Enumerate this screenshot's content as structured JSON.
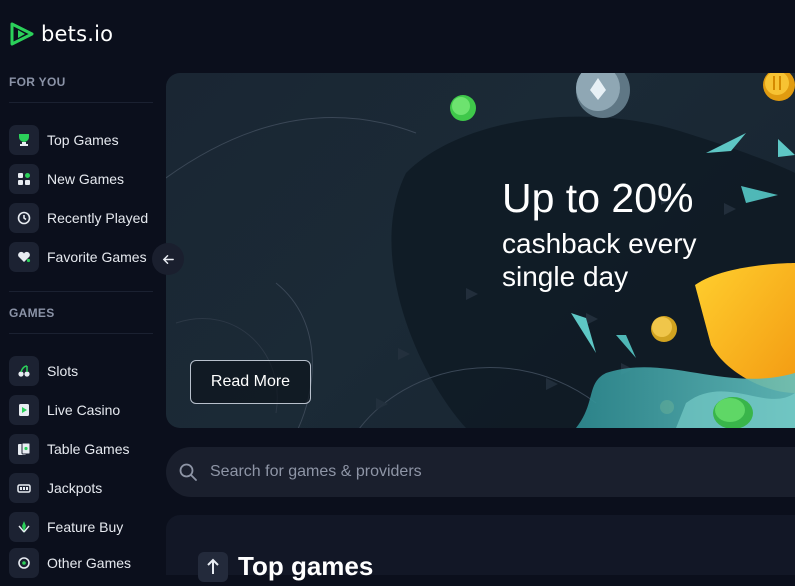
{
  "brand": {
    "name": "bets.io",
    "accent": "#2bd15a"
  },
  "sidebar": {
    "sections": [
      {
        "title": "FOR YOU",
        "items": [
          {
            "label": "Top Games",
            "icon": "trophy-icon"
          },
          {
            "label": "New Games",
            "icon": "new-games-icon"
          },
          {
            "label": "Recently Played",
            "icon": "history-icon"
          },
          {
            "label": "Favorite Games",
            "icon": "heart-icon"
          }
        ]
      },
      {
        "title": "GAMES",
        "items": [
          {
            "label": "Slots",
            "icon": "cherries-icon"
          },
          {
            "label": "Live Casino",
            "icon": "live-card-icon"
          },
          {
            "label": "Table Games",
            "icon": "table-cards-icon"
          },
          {
            "label": "Jackpots",
            "icon": "jackpot-icon"
          },
          {
            "label": "Feature Buy",
            "icon": "feature-buy-icon"
          },
          {
            "label": "Other Games",
            "icon": "other-games-icon"
          }
        ]
      }
    ]
  },
  "banner": {
    "title": "Up to 20%",
    "subtitle": "cashback every single day",
    "button_label": "Read More"
  },
  "search": {
    "placeholder": "Search for games & providers"
  },
  "games_section": {
    "title": "Top games"
  }
}
